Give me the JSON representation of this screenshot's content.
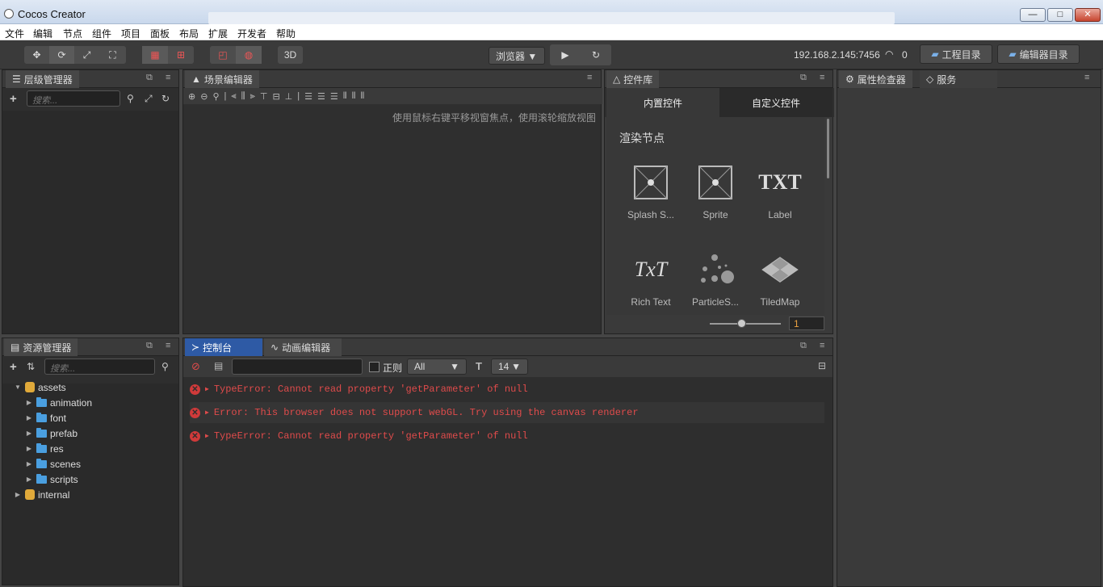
{
  "window": {
    "title": "Cocos Creator",
    "min": "—",
    "max": "□",
    "close": "✕"
  },
  "menu": [
    "文件",
    "编辑",
    "节点",
    "组件",
    "项目",
    "面板",
    "布局",
    "扩展",
    "开发者",
    "帮助"
  ],
  "toolbar": {
    "preview_mode": "浏览器 ▼",
    "toggle_3d": "3D",
    "ip": "192.168.2.145:7456",
    "device_count": "0",
    "project_dir": "工程目录",
    "editor_dir": "编辑器目录"
  },
  "hierarchy": {
    "title": "层级管理器",
    "search_placeholder": "搜索..."
  },
  "scene": {
    "title": "场景编辑器",
    "hint": "使用鼠标右键平移视窗焦点，使用滚轮缩放视图"
  },
  "widgets": {
    "title": "控件库",
    "tabs": [
      "内置控件",
      "自定义控件"
    ],
    "section": "渲染节点",
    "items": [
      "Splash S...",
      "Sprite",
      "Label",
      "Rich Text",
      "ParticleS...",
      "TiledMap"
    ],
    "txt_glyph": "TXT",
    "rich_glyph": "TxT",
    "zoom_value": "1"
  },
  "inspector": {
    "title": "属性检查器",
    "service": "服务"
  },
  "assets": {
    "title": "资源管理器",
    "search_placeholder": "搜索...",
    "root": "assets",
    "children": [
      "animation",
      "font",
      "prefab",
      "res",
      "scenes",
      "scripts"
    ],
    "internal": "internal"
  },
  "console": {
    "title": "控制台",
    "anim_tab": "动画编辑器",
    "regex_label": "正则",
    "level": "All",
    "font_size": "14",
    "logs": [
      "TypeError: Cannot read property 'getParameter' of null",
      "Error: This browser does not support webGL. Try using the canvas renderer",
      "TypeError: Cannot read property 'getParameter' of null"
    ]
  }
}
